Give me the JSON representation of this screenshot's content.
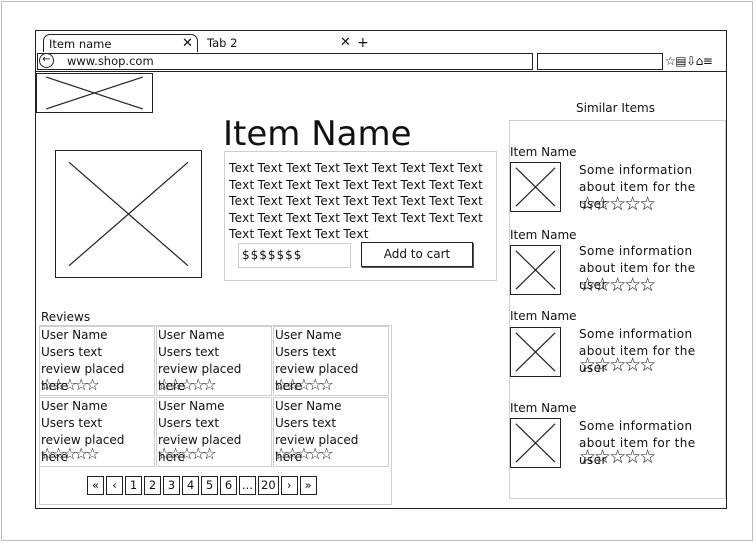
{
  "browser": {
    "tabs": [
      {
        "label": "Item name",
        "close": "✕"
      },
      {
        "label": "Tab 2",
        "close": "✕"
      }
    ],
    "new_tab": "+",
    "back": "←",
    "url": "www.shop.com",
    "toolbar_icons": "☆▤⇩⌂≡"
  },
  "product": {
    "title": "Item Name",
    "description": "Text Text Text Text Text Text Text Text Text Text Text Text Text Text Text Text Text Text Text Text Text Text Text Text Text Text Text Text Text Text Text Text Text Text Text Text Text Text Text Text Text",
    "price": "$$$$$$$",
    "add_to_cart": "Add to cart"
  },
  "reviews": {
    "heading": "Reviews",
    "items": [
      {
        "user": "User Name",
        "text": "Users text\nreview placed\nhere",
        "stars": "☆☆☆☆☆"
      },
      {
        "user": "User Name",
        "text": "Users text\nreview placed\nhere",
        "stars": "☆☆☆☆☆"
      },
      {
        "user": "User Name",
        "text": "Users text\nreview placed\nhere",
        "stars": "☆☆☆☆☆"
      },
      {
        "user": "User Name",
        "text": "Users text\nreview placed\nhere",
        "stars": "☆☆☆☆☆"
      },
      {
        "user": "User Name",
        "text": "Users text\nreview placed\nhere",
        "stars": "☆☆☆☆☆"
      },
      {
        "user": "User Name",
        "text": "Users text\nreview placed\nhere",
        "stars": "☆☆☆☆☆"
      }
    ],
    "pagination": [
      "«",
      "‹",
      "1",
      "2",
      "3",
      "4",
      "5",
      "6",
      "...",
      "20",
      "›",
      "»"
    ]
  },
  "similar": {
    "heading": "Similar Items",
    "items": [
      {
        "name": "Item Name",
        "info": "Some information about item for the user",
        "stars": "☆☆☆☆☆"
      },
      {
        "name": "Item Name",
        "info": "Some information about item for the user",
        "stars": "☆☆☆☆☆"
      },
      {
        "name": "Item Name",
        "info": "Some information about item for the user",
        "stars": "☆☆☆☆☆"
      },
      {
        "name": "Item Name",
        "info": "Some information about item for the user",
        "stars": "☆☆☆☆☆"
      }
    ]
  }
}
